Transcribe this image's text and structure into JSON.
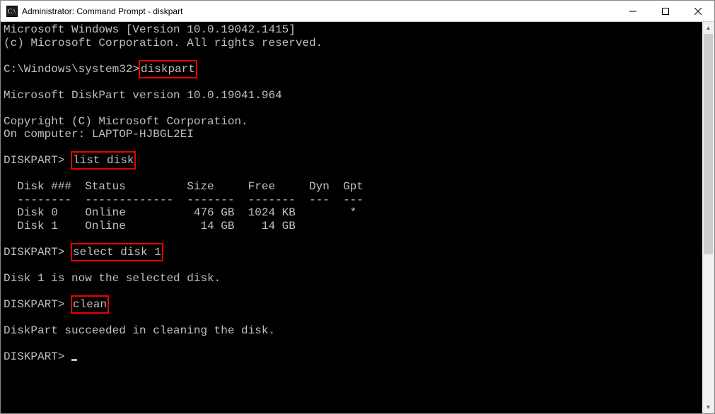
{
  "titlebar": {
    "title": "Administrator: Command Prompt - diskpart"
  },
  "lines": {
    "l0": "Microsoft Windows [Version 10.0.19042.1415]",
    "l1": "(c) Microsoft Corporation. All rights reserved.",
    "prompt1_pre": "C:\\Windows\\system32>",
    "cmd1": "diskpart",
    "l2": "Microsoft DiskPart version 10.0.19041.964",
    "l3": "Copyright (C) Microsoft Corporation.",
    "l4": "On computer: LAPTOP-HJBGL2EI",
    "prompt2_pre": "DISKPART> ",
    "cmd2": "list disk",
    "th": "  Disk ###  Status         Size     Free     Dyn  Gpt",
    "tsep": "  --------  -------------  -------  -------  ---  ---",
    "tr0": "  Disk 0    Online          476 GB  1024 KB        *",
    "tr1": "  Disk 1    Online           14 GB    14 GB",
    "prompt3_pre": "DISKPART> ",
    "cmd3": "select disk 1",
    "l5": "Disk 1 is now the selected disk.",
    "prompt4_pre": "DISKPART> ",
    "cmd4": "clean",
    "l6": "DiskPart succeeded in cleaning the disk.",
    "prompt5_pre": "DISKPART> "
  },
  "disk_table": {
    "headers": [
      "Disk ###",
      "Status",
      "Size",
      "Free",
      "Dyn",
      "Gpt"
    ],
    "rows": [
      {
        "disk": "Disk 0",
        "status": "Online",
        "size": "476 GB",
        "free": "1024 KB",
        "dyn": "",
        "gpt": "*"
      },
      {
        "disk": "Disk 1",
        "status": "Online",
        "size": "14 GB",
        "free": "14 GB",
        "dyn": "",
        "gpt": ""
      }
    ]
  },
  "highlights": [
    "diskpart",
    "list disk",
    "select disk 1",
    "clean"
  ]
}
